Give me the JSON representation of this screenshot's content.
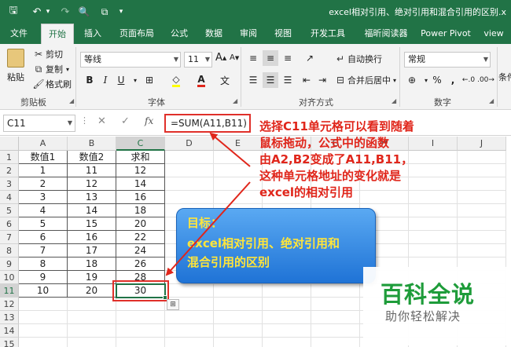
{
  "titlebar": {
    "title": "excel相对引用、绝对引用和混合引用的区别.x",
    "qat": {
      "save": "🖫",
      "undo": "↶",
      "redo": "↷",
      "more": "▾",
      "preview": "🔍",
      "customize": "▾"
    }
  },
  "tabs": [
    {
      "label": "文件",
      "active": false
    },
    {
      "label": "开始",
      "active": true
    },
    {
      "label": "插入",
      "active": false
    },
    {
      "label": "页面布局",
      "active": false
    },
    {
      "label": "公式",
      "active": false
    },
    {
      "label": "数据",
      "active": false
    },
    {
      "label": "审阅",
      "active": false
    },
    {
      "label": "视图",
      "active": false
    },
    {
      "label": "开发工具",
      "active": false
    },
    {
      "label": "福昕阅读器",
      "active": false
    },
    {
      "label": "Power Pivot",
      "active": false
    },
    {
      "label": "view",
      "active": false
    }
  ],
  "ribbon": {
    "clipboard": {
      "paste": "粘贴",
      "cut": "剪切",
      "copy": "复制",
      "format_painter": "格式刷",
      "label": "剪贴板"
    },
    "font": {
      "name": "等线",
      "size": "11",
      "label": "字体",
      "bold": "B",
      "italic": "I",
      "underline": "U",
      "grow": "A",
      "shrink": "A"
    },
    "alignment": {
      "wrap": "自动换行",
      "merge": "合并后居中",
      "label": "对齐方式"
    },
    "number": {
      "format": "常规",
      "label": "数字",
      "percent": "%",
      "comma": ",",
      "currency": "⊕"
    },
    "styles": {
      "conditional": "条件"
    }
  },
  "formula_bar": {
    "name_box": "C11",
    "formula": "=SUM(A11,B11)",
    "fx": "fx"
  },
  "sheet": {
    "columns": [
      "A",
      "B",
      "C",
      "D",
      "E",
      "F",
      "G",
      "H",
      "I",
      "J"
    ],
    "rows": [
      "1",
      "2",
      "3",
      "4",
      "5",
      "6",
      "7",
      "8",
      "9",
      "10",
      "11",
      "12",
      "13",
      "14",
      "15"
    ],
    "header": [
      "数值1",
      "数值2",
      "求和"
    ],
    "data": [
      [
        "1",
        "11",
        "12"
      ],
      [
        "2",
        "12",
        "14"
      ],
      [
        "3",
        "13",
        "16"
      ],
      [
        "4",
        "14",
        "18"
      ],
      [
        "5",
        "15",
        "20"
      ],
      [
        "6",
        "16",
        "22"
      ],
      [
        "7",
        "17",
        "24"
      ],
      [
        "8",
        "18",
        "26"
      ],
      [
        "9",
        "19",
        "28"
      ],
      [
        "10",
        "20",
        "30"
      ]
    ]
  },
  "annotation": {
    "lines": [
      "选择C11单元格可以看到随着",
      "鼠标拖动，公式中的函数",
      "由A2,B2变成了A11,B11，",
      "这种单元格地址的变化就是",
      "excel的相对引用"
    ]
  },
  "bubble": {
    "lines": [
      "目标：",
      "excel相对引用、绝对引用和",
      "混合引用的区别"
    ]
  },
  "watermark": {
    "main": "百科全说",
    "sub": "助你轻松解决"
  },
  "colors": {
    "excel_green": "#217346",
    "annotation_red": "#e0261b",
    "bubble_blue": "#1f73d6",
    "bubble_text": "#ffe53b",
    "watermark_green": "#1e9c3a"
  }
}
